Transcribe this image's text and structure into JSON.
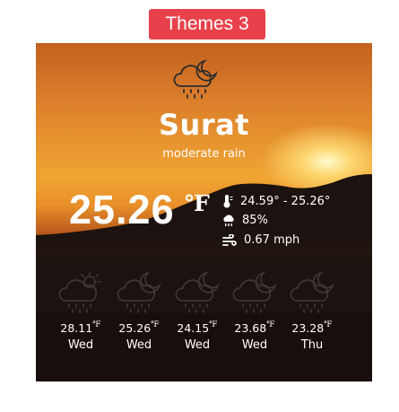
{
  "theme_button": "Themes 3",
  "current": {
    "city": "Surat",
    "description": "moderate rain",
    "temperature": "25.26",
    "unit": "℉",
    "range": "24.59° - 25.26°",
    "humidity": "85%",
    "wind": "0.67 mph",
    "icon": "cloud-moon-rain-icon"
  },
  "forecast": [
    {
      "temp": "28.11",
      "unit": "℉",
      "day": "Wed",
      "icon": "cloud-sun-rain-icon"
    },
    {
      "temp": "25.26",
      "unit": "℉",
      "day": "Wed",
      "icon": "cloud-moon-rain-icon"
    },
    {
      "temp": "24.15",
      "unit": "℉",
      "day": "Wed",
      "icon": "cloud-moon-rain-icon"
    },
    {
      "temp": "23.68",
      "unit": "℉",
      "day": "Wed",
      "icon": "cloud-moon-rain-icon"
    },
    {
      "temp": "23.28",
      "unit": "℉",
      "day": "Thu",
      "icon": "cloud-moon-rain-icon"
    }
  ],
  "colors": {
    "accent": "#e8414b",
    "text": "#ffffff"
  }
}
